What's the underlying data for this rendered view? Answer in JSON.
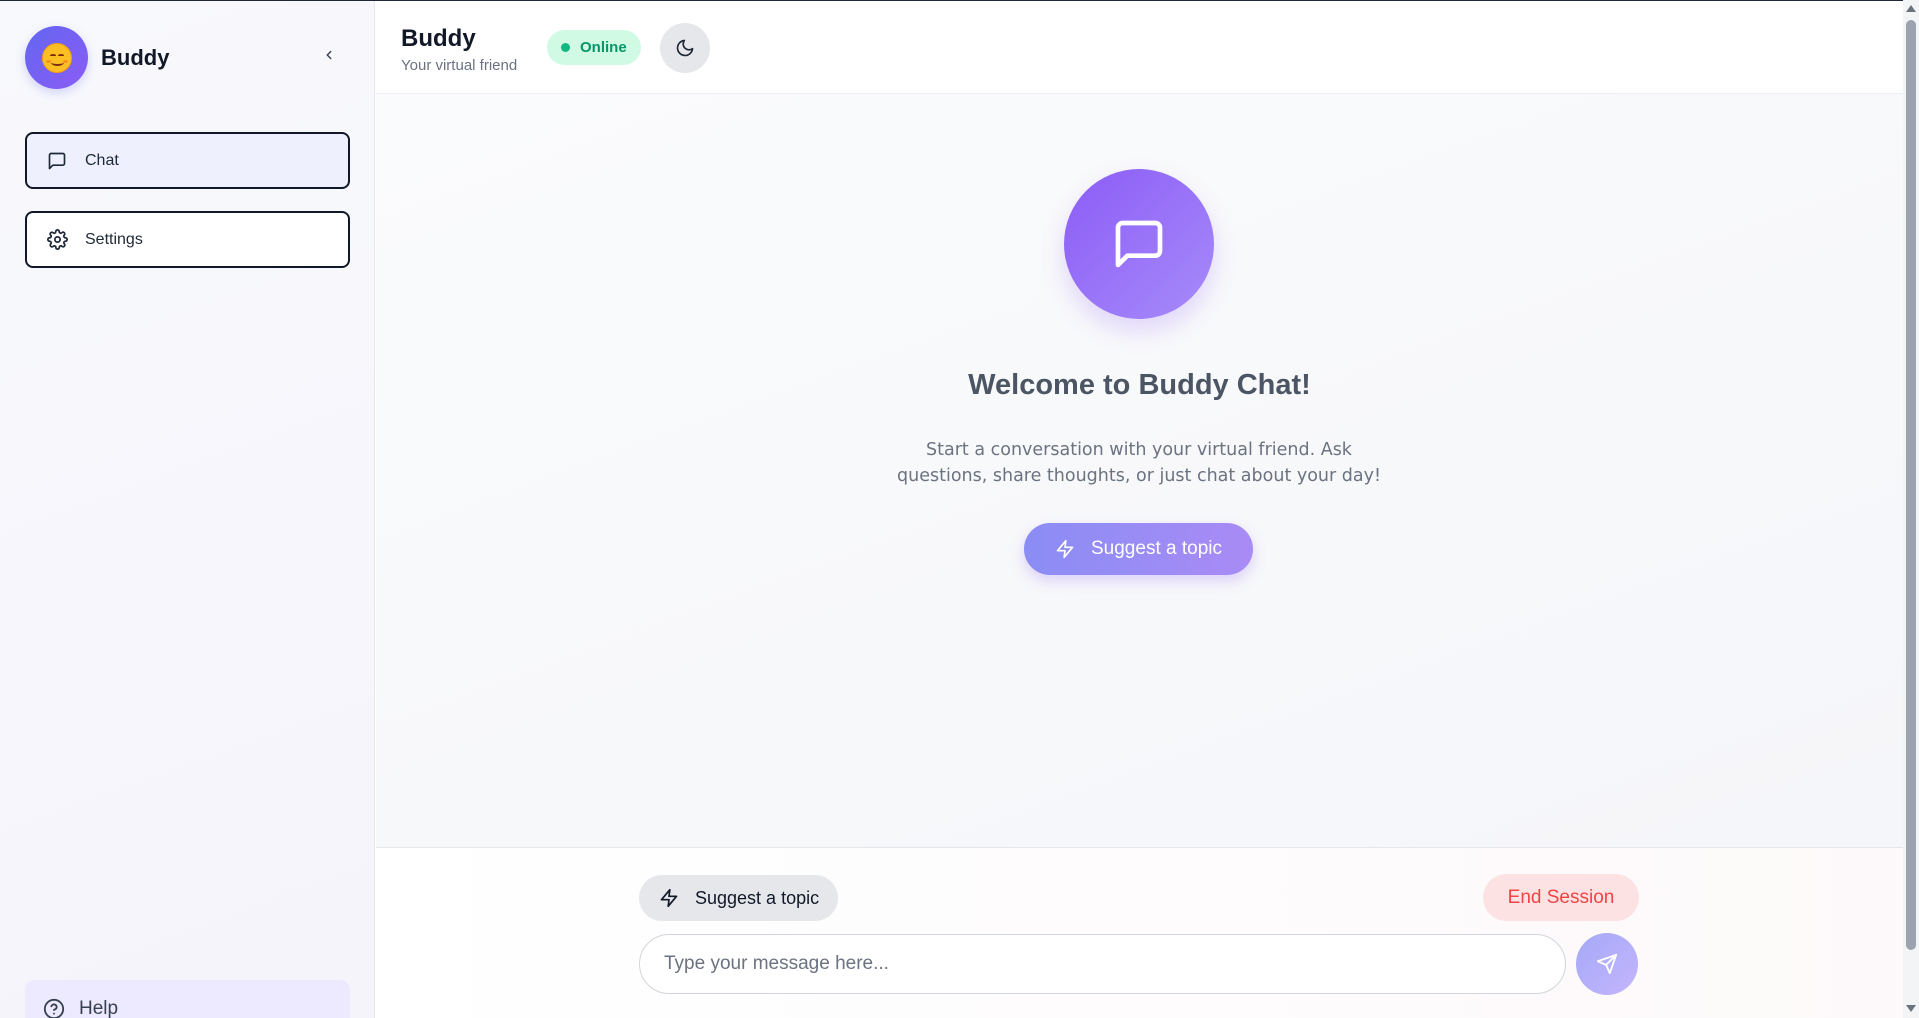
{
  "app": {
    "brand_name": "Buddy"
  },
  "sidebar": {
    "items": [
      {
        "label": "Chat",
        "icon": "message-square-icon",
        "active": true
      },
      {
        "label": "Settings",
        "icon": "gear-icon",
        "active": false
      }
    ],
    "help_label": "Help"
  },
  "header": {
    "title": "Buddy",
    "subtitle": "Your virtual friend",
    "status": "Online"
  },
  "main": {
    "welcome_title": "Welcome to Buddy Chat!",
    "welcome_desc": "Start a conversation with your virtual friend. Ask questions, share thoughts, or just chat about your day!",
    "suggest_button": "Suggest a topic"
  },
  "footer": {
    "suggest_chip": "Suggest a topic",
    "end_session": "End Session",
    "input_placeholder": "Type your message here...",
    "input_value": ""
  },
  "colors": {
    "accent": "#8b5cf6",
    "accent_light": "#a78bfa",
    "status_green": "#10b981",
    "danger": "#ef4444"
  }
}
